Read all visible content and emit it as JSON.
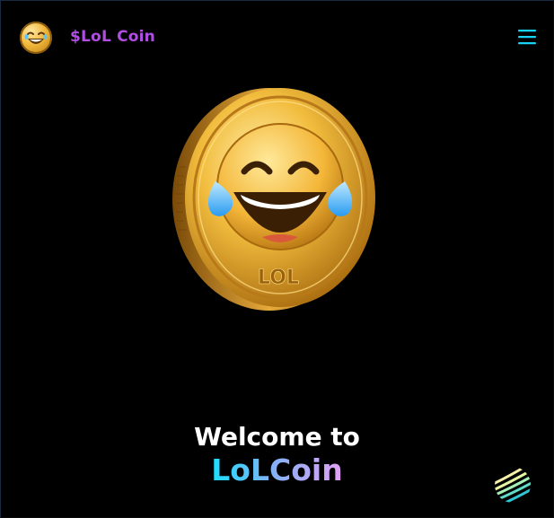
{
  "header": {
    "brand": "$LoL Coin",
    "logo_icon": "laughing-face-icon",
    "menu_icon": "hamburger-menu-icon"
  },
  "hero": {
    "image": "lol-coin-image",
    "coin_text": "LOL",
    "welcome": "Welcome to",
    "name": "LoLCoin"
  },
  "widget": {
    "icon": "striped-globe-icon"
  },
  "colors": {
    "background": "#000000",
    "brand": "#b04ee3",
    "menu": "#19d3f5",
    "gradient_start": "#19e0ff",
    "gradient_end": "#e3a1f5",
    "coin_gold": "#e5a52c"
  }
}
